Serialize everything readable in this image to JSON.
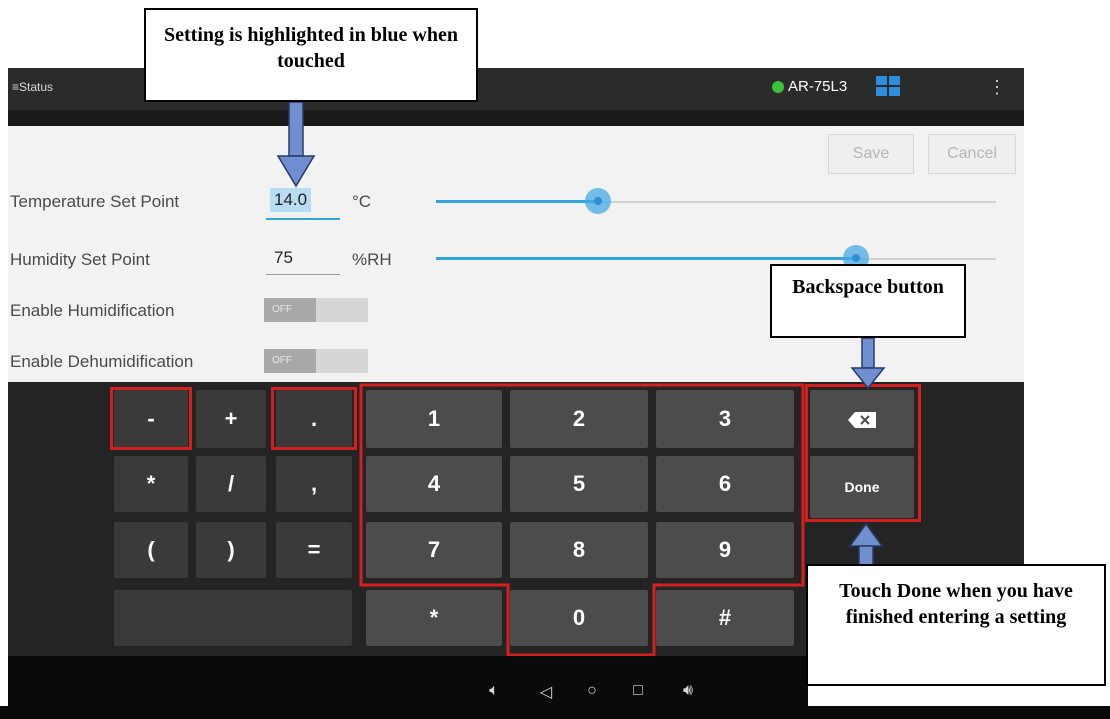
{
  "appbar": {
    "title": "Status",
    "device_name": "AR-75L3",
    "device_status_color": "#39c43a"
  },
  "panel": {
    "save_label": "Save",
    "cancel_label": "Cancel",
    "rows": [
      {
        "label": "Temperature Set Point",
        "value": "14.0",
        "unit": "°C",
        "slider_fraction": 0.29
      },
      {
        "label": "Humidity Set Point",
        "value": "75",
        "unit": "%RH",
        "slider_fraction": 0.75
      },
      {
        "label": "Enable Humidification",
        "toggle": "OFF"
      },
      {
        "label": "Enable Dehumidification",
        "toggle": "OFF"
      }
    ]
  },
  "keyboard": {
    "symbols": [
      "-",
      "+",
      ".",
      "*",
      "/",
      ",",
      "(",
      ")",
      "="
    ],
    "digits": [
      "1",
      "2",
      "3",
      "4",
      "5",
      "6",
      "7",
      "8",
      "9",
      "*",
      "0",
      "#"
    ],
    "backspace_icon": "backspace-icon",
    "done_label": "Done"
  },
  "navbar": {
    "icons": [
      "volume-down-icon",
      "back-icon",
      "home-icon",
      "recents-icon",
      "volume-up-icon"
    ]
  },
  "callouts": {
    "highlight": "Setting is highlighted in blue when touched",
    "backspace": "Backspace button",
    "done": "Touch Done when you have finished entering a setting"
  },
  "colors": {
    "highlight_red": "#d41f1f",
    "accent_blue": "#35a3dd",
    "arrow_blue": "#6f8fd0"
  }
}
